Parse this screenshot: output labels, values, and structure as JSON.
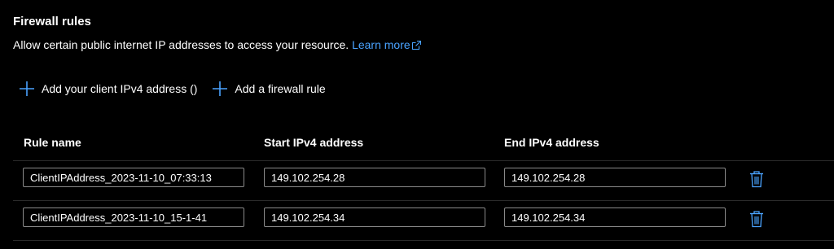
{
  "section": {
    "title": "Firewall rules",
    "description": "Allow certain public internet IP addresses to access your resource.",
    "learn_more": "Learn more"
  },
  "actions": {
    "add_client": "Add your client IPv4 address ()",
    "add_rule": "Add a firewall rule"
  },
  "table": {
    "headers": [
      "Rule name",
      "Start IPv4 address",
      "End IPv4 address"
    ],
    "rows": [
      {
        "name": "ClientIPAddress_2023-11-10_07:33:13",
        "start": "149.102.254.28",
        "end": "149.102.254.28"
      },
      {
        "name": "ClientIPAddress_2023-11-10_15-1-41",
        "start": "149.102.254.34",
        "end": "149.102.254.34"
      }
    ]
  },
  "colors": {
    "accent": "#4aa3ff",
    "background": "#000000",
    "text": "#ffffff"
  },
  "icons": {
    "external": "external-link-icon",
    "add": "plus-icon",
    "delete": "trash-icon"
  }
}
